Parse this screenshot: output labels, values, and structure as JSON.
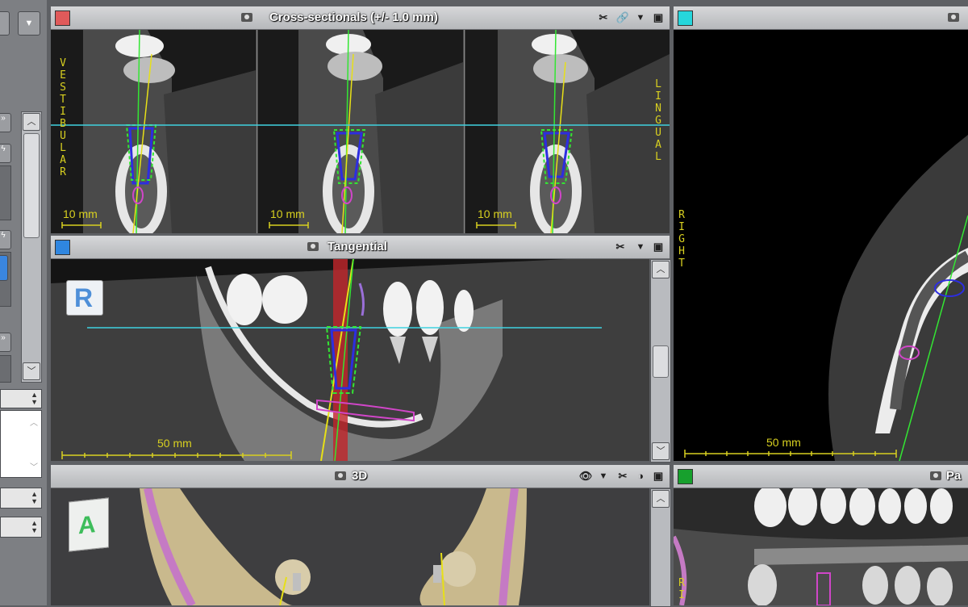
{
  "panels": {
    "cross_sectionals": {
      "title": "Cross-sectionals (+/- 1.0 mm)",
      "swatch": "#e05a5a",
      "scale_label": "10 mm",
      "side_left": "VESTIBULAR",
      "side_right": "LINGUAL"
    },
    "tangential": {
      "title": "Tangential",
      "swatch": "#2f86e0",
      "scale_label": "50 mm",
      "orientation_letter": "R"
    },
    "axial": {
      "swatch": "#26d6dc",
      "scale_label": "50 mm",
      "side_label": "RIGHT"
    },
    "three_d": {
      "title": "3D",
      "orientation_letter": "A"
    },
    "panoramic": {
      "title": "Pa",
      "swatch": "#17a02d",
      "side_label": "RI"
    }
  }
}
